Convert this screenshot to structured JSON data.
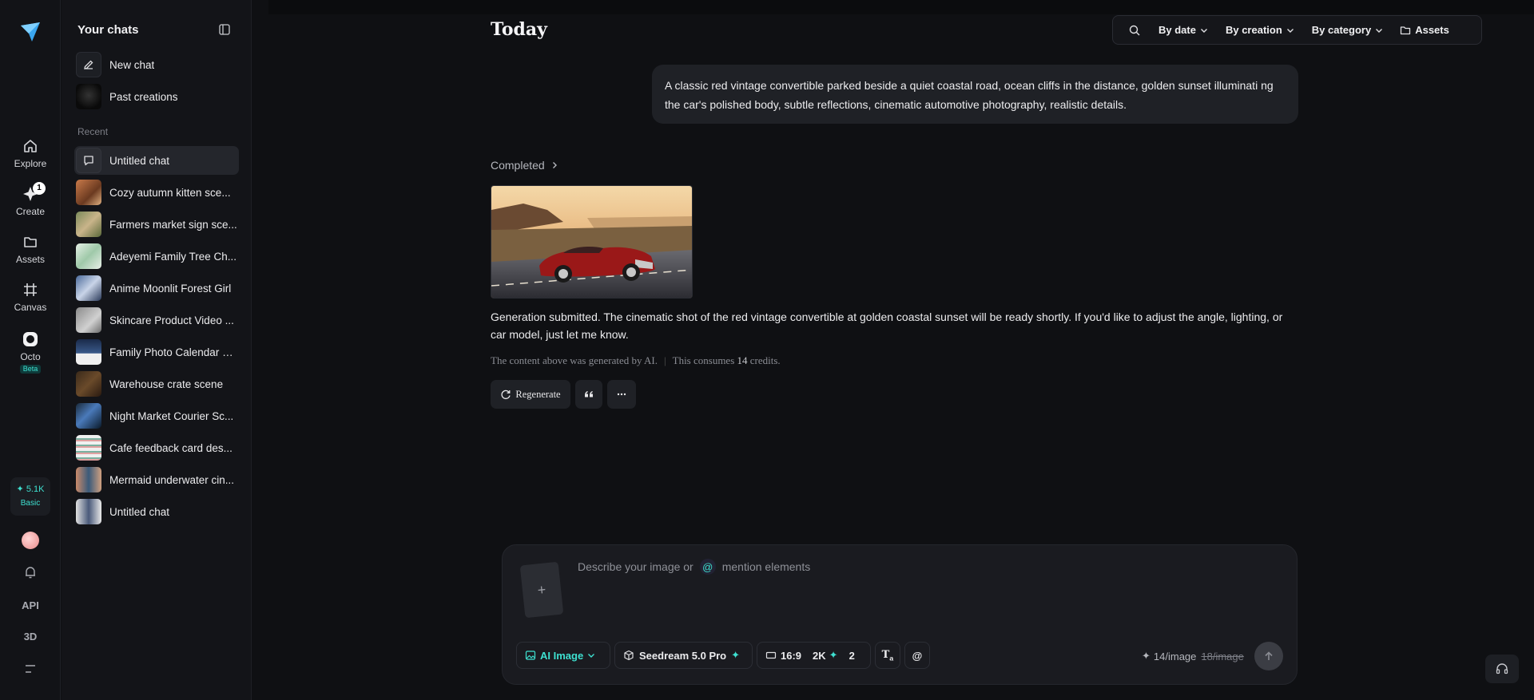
{
  "rail": {
    "items": [
      {
        "label": "Explore"
      },
      {
        "label": "Create",
        "badge": "1"
      },
      {
        "label": "Assets"
      },
      {
        "label": "Canvas"
      },
      {
        "label": "Octo",
        "tag": "Beta"
      }
    ],
    "credits": {
      "amount": "5.1K",
      "plan": "Basic"
    },
    "bottom": [
      "API",
      "3D"
    ]
  },
  "sidebar": {
    "title": "Your chats",
    "new_chat": "New chat",
    "past_creations": "Past creations",
    "recent_label": "Recent",
    "chats": [
      "Untitled chat",
      "Cozy autumn kitten sce...",
      "Farmers market sign sce...",
      "Adeyemi Family Tree Ch...",
      "Anime Moonlit Forest Girl",
      "Skincare Product Video ...",
      "Family Photo Calendar E...",
      "Warehouse crate scene",
      "Night Market Courier Sc...",
      "Cafe feedback card des...",
      "Mermaid underwater cin...",
      "Untitled chat"
    ]
  },
  "main": {
    "heading": "Today",
    "toolbar": {
      "by_date": "By date",
      "by_creation": "By creation",
      "by_category": "By category",
      "assets": "Assets"
    },
    "prompt": "A classic red vintage convertible parked beside a quiet coastal road, ocean cliffs in the distance, golden sunset illuminati ng the car's polished body, subtle reflections, cinematic automotive photography, realistic details.",
    "status": "Completed",
    "reply": "Generation submitted. The cinematic shot of the red vintage convertible at golden coastal sunset will be ready shortly. If you'd like to adjust the angle, lighting, or car model, just let me know.",
    "meta": {
      "ai_note": "The content above was generated by AI.",
      "consumes_prefix": "This consumes",
      "credits": "14",
      "consumes_suffix": "credits."
    },
    "actions": {
      "regenerate": "Regenerate"
    }
  },
  "composer": {
    "placeholder_a": "Describe your image or",
    "placeholder_b": "mention elements",
    "mode": "AI Image",
    "model": "Seedream 5.0 Pro",
    "ratio": "16:9",
    "resolution": "2K",
    "count": "2",
    "cost": "14/image",
    "cost_original": "18/image"
  },
  "colors": {
    "accent": "#3ee0d0",
    "background": "#0f1013",
    "panel": "#131418"
  }
}
